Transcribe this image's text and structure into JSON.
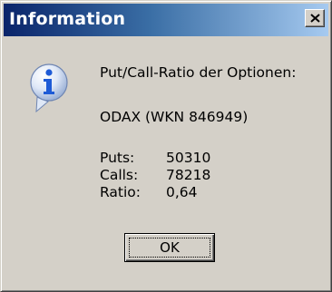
{
  "window": {
    "title": "Information",
    "close_icon": "close-icon"
  },
  "message": {
    "icon": "info-icon",
    "line1": "Put/Call-Ratio der Optionen:",
    "line2": "ODAX (WKN 846949)"
  },
  "stats": [
    {
      "label": "Puts:",
      "value": "50310"
    },
    {
      "label": "Calls:",
      "value": "78218"
    },
    {
      "label": "Ratio:",
      "value": "0,64"
    }
  ],
  "buttons": {
    "ok_label": "OK"
  },
  "colors": {
    "title_bar_start": "#0a246a",
    "title_bar_end": "#a6caf0",
    "dialog_face": "#d4d0c8",
    "icon_blue": "#1e5bd6"
  }
}
